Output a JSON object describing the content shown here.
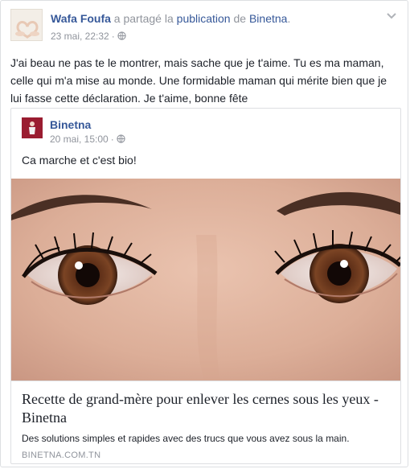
{
  "post": {
    "author": "Wafa Foufa",
    "action_prefix": " a partagé la ",
    "action_link": "publication",
    "action_mid": " de ",
    "page_name": "Binetna",
    "action_suffix": ".",
    "timestamp": "23 mai, 22:32",
    "separator": "·",
    "privacy_icon": "globe-icon",
    "menu_icon": "chevron-down-icon",
    "text": "J'ai beau ne pas te le montrer, mais sache que je t'aime. Tu es ma maman, celle qui m'a mise au monde. Une formidable maman qui mérite bien que je lui fasse cette déclaration. Je t'aime, bonne fête"
  },
  "shared_post": {
    "page_name": "Binetna",
    "timestamp": "20 mai, 15:00",
    "separator": "·",
    "privacy_icon": "globe-icon",
    "text": "Ca marche et c'est bio!",
    "link": {
      "title": "Recette de grand-mère pour enlever les cernes sous les yeux - Binetna",
      "description": "Des solutions simples et rapides avec des trucs que vous avez sous la main.",
      "domain": "BINETNA.COM.TN"
    }
  },
  "colors": {
    "link_blue": "#365899",
    "meta_gray": "#90949c",
    "text": "#1d2129",
    "border": "#dddfe2"
  }
}
